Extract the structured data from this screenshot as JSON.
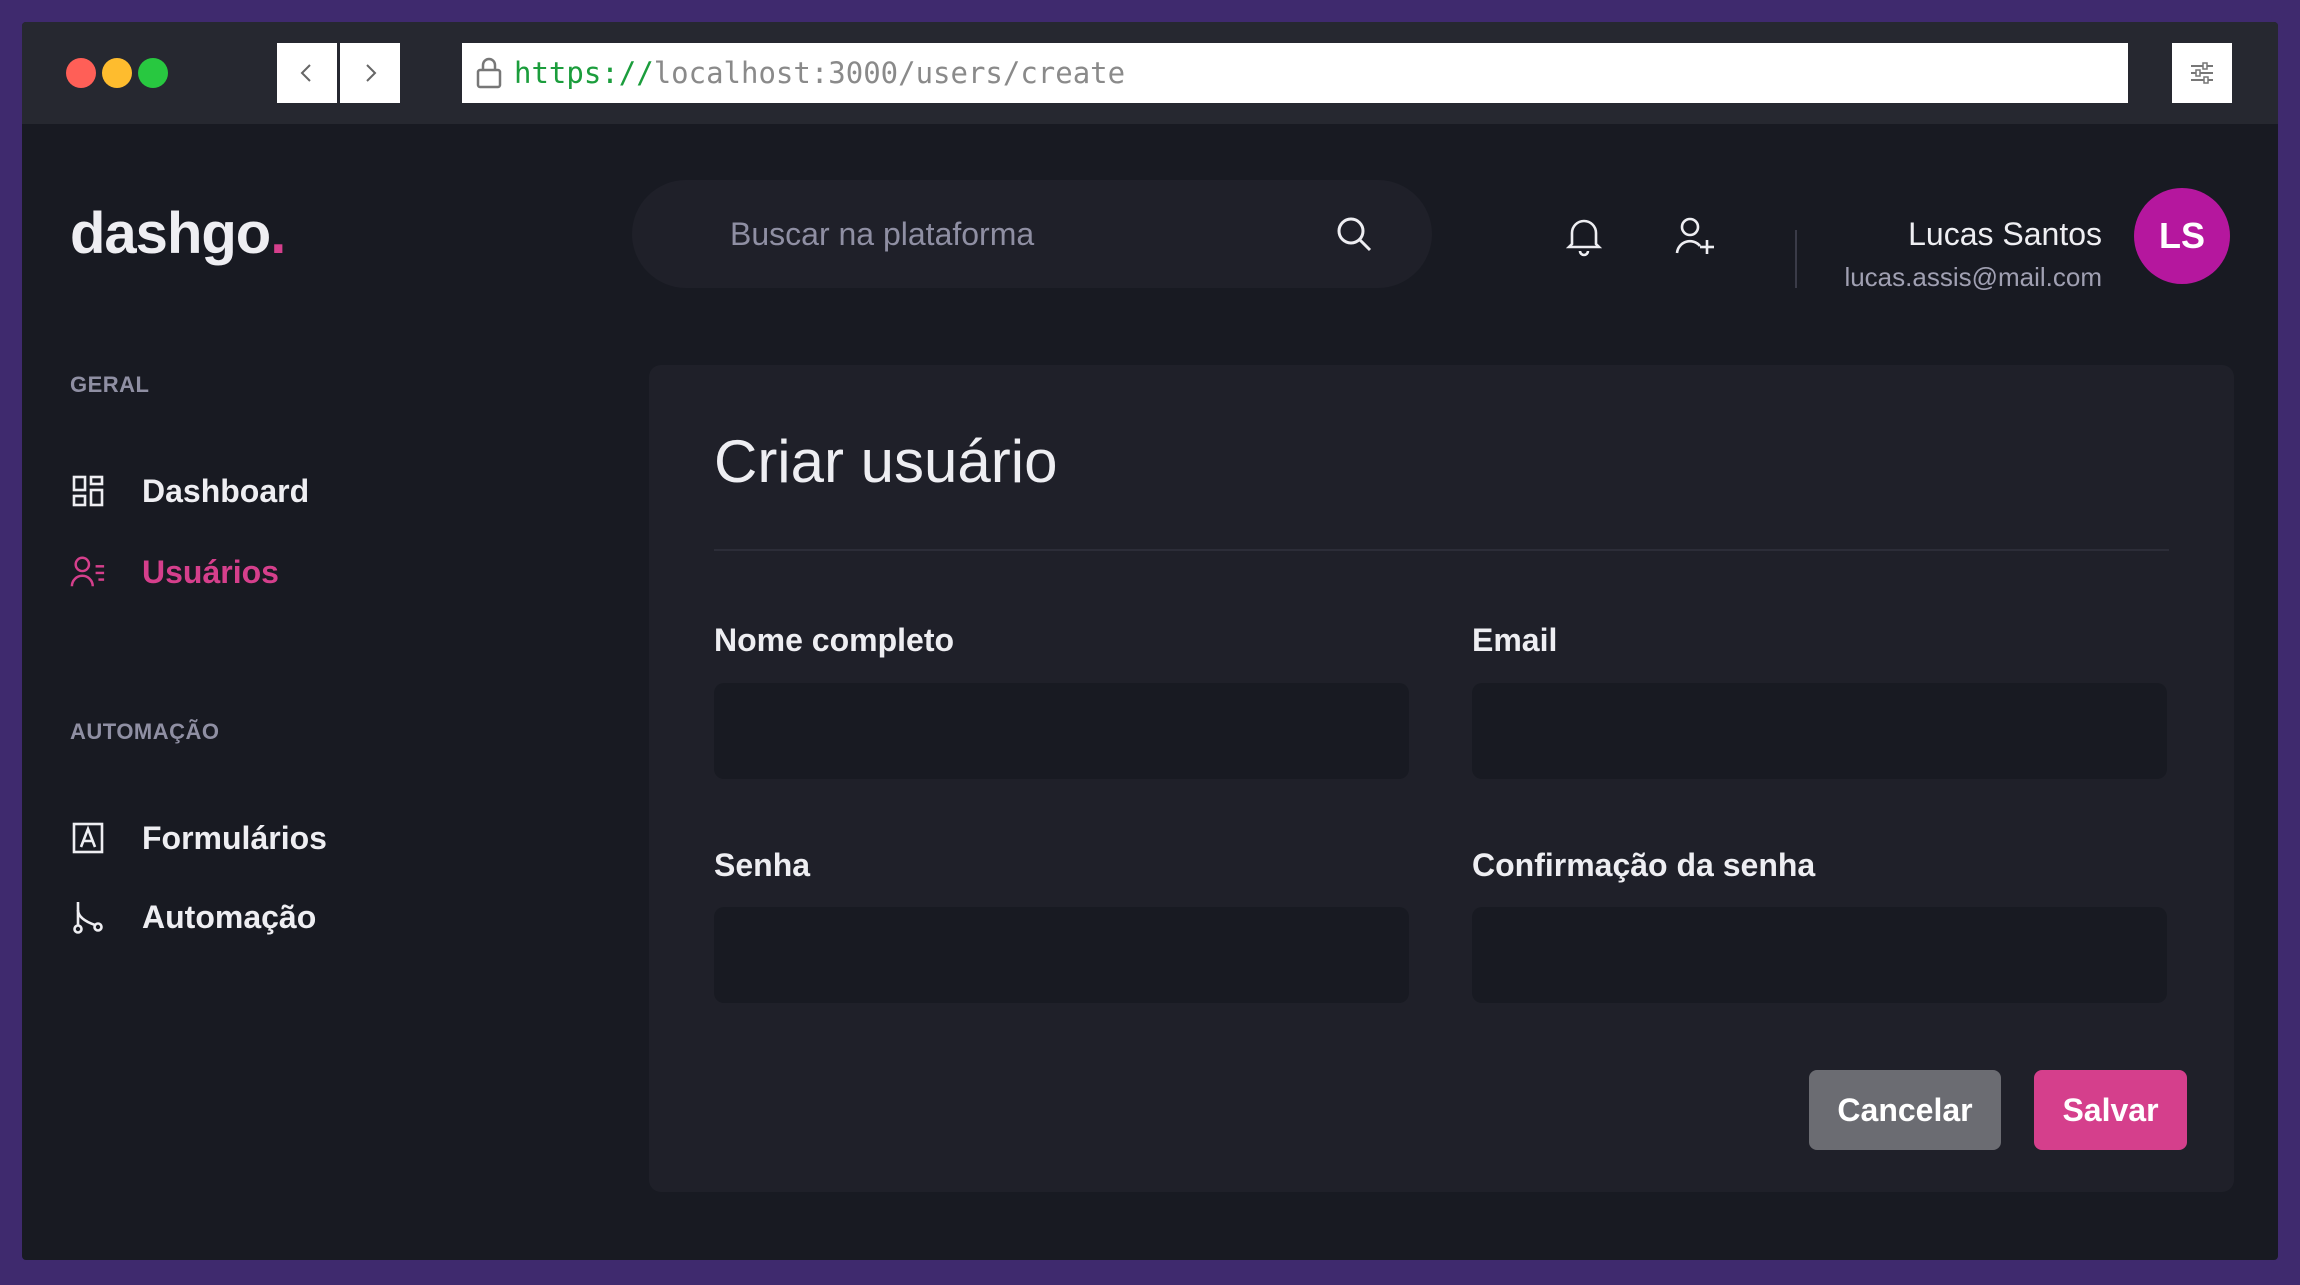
{
  "browser": {
    "url_scheme": "https://",
    "url_rest": "localhost:3000/users/create",
    "icons": {
      "back": "chevron-left-icon",
      "forward": "chevron-right-icon",
      "lock": "lock-icon",
      "menu": "sliders-icon"
    }
  },
  "logo": {
    "text": "dashgo",
    "dot": ".",
    "accent_color": "#d53f8c"
  },
  "sidebar": {
    "sections": [
      {
        "title": "GERAL",
        "items": [
          {
            "label": "Dashboard",
            "icon": "dashboard-icon",
            "active": false
          },
          {
            "label": "Usuários",
            "icon": "users-icon",
            "active": true
          }
        ]
      },
      {
        "title": "AUTOMAÇÃO",
        "items": [
          {
            "label": "Formulários",
            "icon": "form-icon",
            "active": false
          },
          {
            "label": "Automação",
            "icon": "git-branch-icon",
            "active": false
          }
        ]
      }
    ]
  },
  "header": {
    "search": {
      "placeholder": "Buscar na plataforma",
      "value": "",
      "icon": "search-icon"
    },
    "icons": [
      "bell-icon",
      "add-user-icon"
    ],
    "user": {
      "name": "Lucas Santos",
      "email": "lucas.assis@mail.com",
      "initials": "LS",
      "avatar_color": "#b5179e"
    }
  },
  "form": {
    "title": "Criar usuário",
    "fields": [
      {
        "label": "Nome completo",
        "value": ""
      },
      {
        "label": "Email",
        "value": ""
      },
      {
        "label": "Senha",
        "value": ""
      },
      {
        "label": "Confirmação da senha",
        "value": ""
      }
    ],
    "cancel_label": "Cancelar",
    "save_label": "Salvar"
  },
  "colors": {
    "background": "#181a22",
    "card": "#1f2029",
    "accent": "#d53f8c",
    "frame": "#3f2a6e"
  }
}
